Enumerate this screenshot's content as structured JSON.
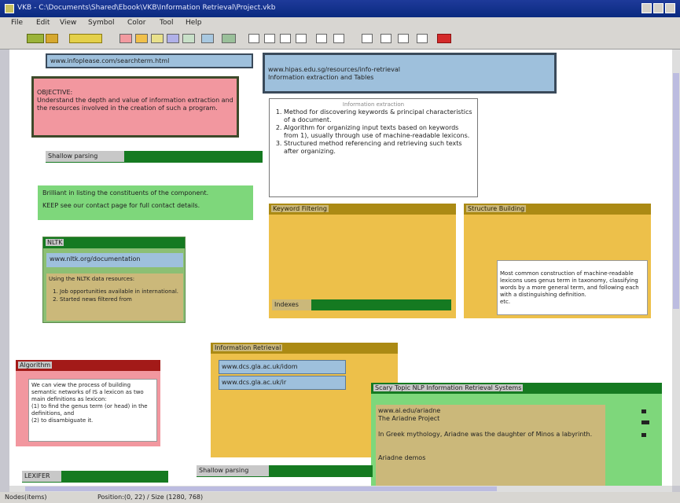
{
  "window": {
    "title": "VKB - C:\\Documents\\Shared\\Ebook\\VKB\\Information Retrieval\\Project.vkb"
  },
  "menu": [
    "File",
    "Edit",
    "View",
    "Symbol",
    "Color",
    "Tool",
    "Help"
  ],
  "nodes": {
    "url_top_left": "www.infoplease.com/searchterm.html",
    "url_top_right": "www.hipas.edu.sg/resources/info-retrieval\nInformation extraction and Tables",
    "objective": "OBJECTIVE:\nUnderstand the depth and value of information extraction and the resources involved in the creation of such a program.",
    "method_list": [
      "Method for discovering keywords & principal characteristics of a document.",
      "Algorithm for organizing input texts based on keywords from 1), usually through use of machine-readable lexicons.",
      "Structured method referencing and retrieving such texts after organizing."
    ],
    "method_title": "Information extraction",
    "shallow_bar": "Shallow parsing",
    "contact_line1": "Brilliant in listing the constituents of the component.",
    "contact_line2": "KEEP see our contact page for full contact details.",
    "keyword_title": "Keyword Filtering",
    "keyword_footer": "Indexes",
    "structure_title": "Structure Building",
    "structure_text": "Most common construction of machine-readable lexicons uses genus term in taxonomy, classifying words by a more general term, and following each with a distinguishing definition.\netc.",
    "green_panel_title": "NLTK",
    "green_panel_url": "www.nltk.org/documentation",
    "green_panel_sub": "Using the NLTK data resources:",
    "green_panel_list": [
      "Job opportunities available in international.",
      "Started news filtered from"
    ],
    "red_panel_title": "Algorithm",
    "red_panel_text": "We can view the process of building semantic networks of IS a lexicon as two main definitions as lexicon:\n(1) to find the genus term (or head) in the definitions, and\n(2) to disambiguate it.",
    "ir_title": "Information Retrieval",
    "ir_url1": "www.dcs.gla.ac.uk/idom",
    "ir_url2": "www.dcs.gla.ac.uk/ir",
    "nlp_title": "Scary Topic NLP Information Retrieval Systems",
    "nlp_text": "www.ai.edu/ariadne\nThe Ariadne Project\n\nIn Greek mythology, Ariadne was the daughter of Minos a labyrinth.\n\n\nAriadne demos",
    "parsing_bar": "Shallow parsing",
    "corner_bar": "LEXIFER"
  },
  "status": {
    "left": "Nodes(items)",
    "right": "Position:(0, 22) / Size (1280, 768)"
  },
  "colors": {
    "blue": "#9ec0dc",
    "pink": "#f2979f",
    "green": "#7ed77b",
    "dark_green": "#157a21",
    "gold": "#edc04a",
    "olive": "#ab8a14",
    "khaki": "#cbb87a",
    "dark_red": "#a31a18"
  }
}
